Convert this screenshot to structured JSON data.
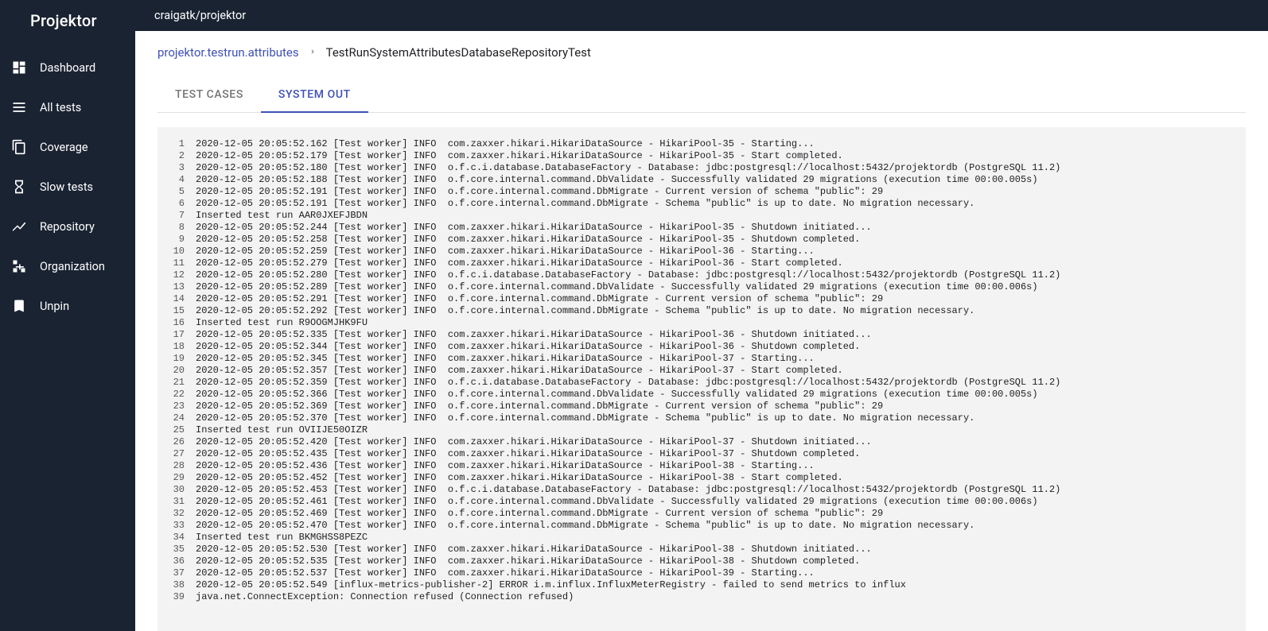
{
  "app_name": "Projektor",
  "repo_path": "craigatk/projektor",
  "sidebar": {
    "items": [
      {
        "label": "Dashboard",
        "icon": "dashboard-icon"
      },
      {
        "label": "All tests",
        "icon": "list-icon"
      },
      {
        "label": "Coverage",
        "icon": "copy-icon"
      },
      {
        "label": "Slow tests",
        "icon": "hourglass-icon"
      },
      {
        "label": "Repository",
        "icon": "timeline-icon"
      },
      {
        "label": "Organization",
        "icon": "org-icon"
      },
      {
        "label": "Unpin",
        "icon": "bookmark-icon"
      }
    ]
  },
  "breadcrumb": {
    "link_label": "projektor.testrun.attributes",
    "current": "TestRunSystemAttributesDatabaseRepositoryTest"
  },
  "tabs": {
    "items": [
      {
        "label": "TEST CASES",
        "active": false
      },
      {
        "label": "SYSTEM OUT",
        "active": true
      }
    ]
  },
  "log_lines": [
    "2020-12-05 20:05:52.162 [Test worker] INFO  com.zaxxer.hikari.HikariDataSource - HikariPool-35 - Starting...",
    "2020-12-05 20:05:52.179 [Test worker] INFO  com.zaxxer.hikari.HikariDataSource - HikariPool-35 - Start completed.",
    "2020-12-05 20:05:52.180 [Test worker] INFO  o.f.c.i.database.DatabaseFactory - Database: jdbc:postgresql://localhost:5432/projektordb (PostgreSQL 11.2)",
    "2020-12-05 20:05:52.188 [Test worker] INFO  o.f.core.internal.command.DbValidate - Successfully validated 29 migrations (execution time 00:00.005s)",
    "2020-12-05 20:05:52.191 [Test worker] INFO  o.f.core.internal.command.DbMigrate - Current version of schema \"public\": 29",
    "2020-12-05 20:05:52.191 [Test worker] INFO  o.f.core.internal.command.DbMigrate - Schema \"public\" is up to date. No migration necessary.",
    "Inserted test run AAR0JXEFJBDN",
    "2020-12-05 20:05:52.244 [Test worker] INFO  com.zaxxer.hikari.HikariDataSource - HikariPool-35 - Shutdown initiated...",
    "2020-12-05 20:05:52.258 [Test worker] INFO  com.zaxxer.hikari.HikariDataSource - HikariPool-35 - Shutdown completed.",
    "2020-12-05 20:05:52.259 [Test worker] INFO  com.zaxxer.hikari.HikariDataSource - HikariPool-36 - Starting...",
    "2020-12-05 20:05:52.279 [Test worker] INFO  com.zaxxer.hikari.HikariDataSource - HikariPool-36 - Start completed.",
    "2020-12-05 20:05:52.280 [Test worker] INFO  o.f.c.i.database.DatabaseFactory - Database: jdbc:postgresql://localhost:5432/projektordb (PostgreSQL 11.2)",
    "2020-12-05 20:05:52.289 [Test worker] INFO  o.f.core.internal.command.DbValidate - Successfully validated 29 migrations (execution time 00:00.006s)",
    "2020-12-05 20:05:52.291 [Test worker] INFO  o.f.core.internal.command.DbMigrate - Current version of schema \"public\": 29",
    "2020-12-05 20:05:52.292 [Test worker] INFO  o.f.core.internal.command.DbMigrate - Schema \"public\" is up to date. No migration necessary.",
    "Inserted test run R9OOGMJHK9FU",
    "2020-12-05 20:05:52.335 [Test worker] INFO  com.zaxxer.hikari.HikariDataSource - HikariPool-36 - Shutdown initiated...",
    "2020-12-05 20:05:52.344 [Test worker] INFO  com.zaxxer.hikari.HikariDataSource - HikariPool-36 - Shutdown completed.",
    "2020-12-05 20:05:52.345 [Test worker] INFO  com.zaxxer.hikari.HikariDataSource - HikariPool-37 - Starting...",
    "2020-12-05 20:05:52.357 [Test worker] INFO  com.zaxxer.hikari.HikariDataSource - HikariPool-37 - Start completed.",
    "2020-12-05 20:05:52.359 [Test worker] INFO  o.f.c.i.database.DatabaseFactory - Database: jdbc:postgresql://localhost:5432/projektordb (PostgreSQL 11.2)",
    "2020-12-05 20:05:52.366 [Test worker] INFO  o.f.core.internal.command.DbValidate - Successfully validated 29 migrations (execution time 00:00.005s)",
    "2020-12-05 20:05:52.369 [Test worker] INFO  o.f.core.internal.command.DbMigrate - Current version of schema \"public\": 29",
    "2020-12-05 20:05:52.370 [Test worker] INFO  o.f.core.internal.command.DbMigrate - Schema \"public\" is up to date. No migration necessary.",
    "Inserted test run OVIIJE50OIZR",
    "2020-12-05 20:05:52.420 [Test worker] INFO  com.zaxxer.hikari.HikariDataSource - HikariPool-37 - Shutdown initiated...",
    "2020-12-05 20:05:52.435 [Test worker] INFO  com.zaxxer.hikari.HikariDataSource - HikariPool-37 - Shutdown completed.",
    "2020-12-05 20:05:52.436 [Test worker] INFO  com.zaxxer.hikari.HikariDataSource - HikariPool-38 - Starting...",
    "2020-12-05 20:05:52.452 [Test worker] INFO  com.zaxxer.hikari.HikariDataSource - HikariPool-38 - Start completed.",
    "2020-12-05 20:05:52.453 [Test worker] INFO  o.f.c.i.database.DatabaseFactory - Database: jdbc:postgresql://localhost:5432/projektordb (PostgreSQL 11.2)",
    "2020-12-05 20:05:52.461 [Test worker] INFO  o.f.core.internal.command.DbValidate - Successfully validated 29 migrations (execution time 00:00.006s)",
    "2020-12-05 20:05:52.469 [Test worker] INFO  o.f.core.internal.command.DbMigrate - Current version of schema \"public\": 29",
    "2020-12-05 20:05:52.470 [Test worker] INFO  o.f.core.internal.command.DbMigrate - Schema \"public\" is up to date. No migration necessary.",
    "Inserted test run BKMGHSS8PEZC",
    "2020-12-05 20:05:52.530 [Test worker] INFO  com.zaxxer.hikari.HikariDataSource - HikariPool-38 - Shutdown initiated...",
    "2020-12-05 20:05:52.535 [Test worker] INFO  com.zaxxer.hikari.HikariDataSource - HikariPool-38 - Shutdown completed.",
    "2020-12-05 20:05:52.537 [Test worker] INFO  com.zaxxer.hikari.HikariDataSource - HikariPool-39 - Starting...",
    "2020-12-05 20:05:52.549 [influx-metrics-publisher-2] ERROR i.m.influx.InfluxMeterRegistry - failed to send metrics to influx",
    "java.net.ConnectException: Connection refused (Connection refused)"
  ]
}
